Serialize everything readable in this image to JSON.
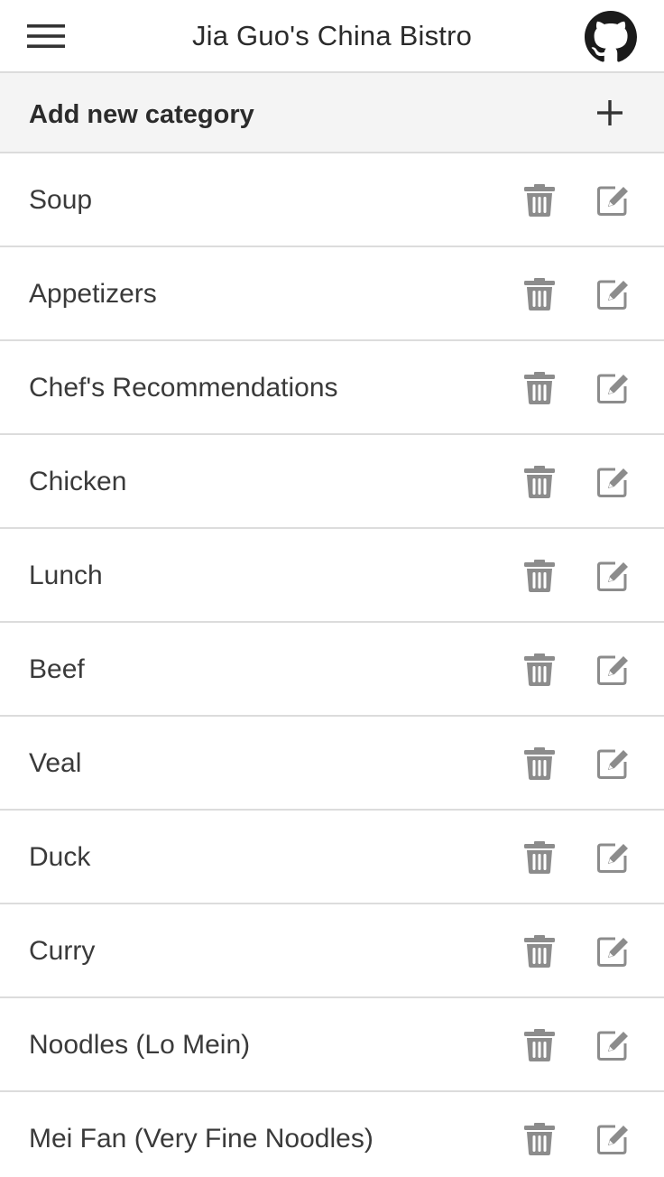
{
  "header": {
    "title": "Jia Guo's China Bistro",
    "menu_icon": "hamburger-menu-icon",
    "github_icon": "github-icon"
  },
  "add_category": {
    "label": "Add new category",
    "icon": "plus-icon"
  },
  "categories": [
    {
      "label": "Soup"
    },
    {
      "label": "Appetizers"
    },
    {
      "label": "Chef's Recommendations"
    },
    {
      "label": "Chicken"
    },
    {
      "label": "Lunch"
    },
    {
      "label": "Beef"
    },
    {
      "label": "Veal"
    },
    {
      "label": "Duck"
    },
    {
      "label": "Curry"
    },
    {
      "label": "Noodles (Lo Mein)"
    },
    {
      "label": "Mei Fan (Very Fine Noodles)"
    }
  ],
  "row_icons": {
    "delete": "trash-icon",
    "edit": "edit-icon"
  },
  "colors": {
    "icon_gray": "#8c8c8c",
    "divider": "#dcdcdc",
    "add_row_bg": "#f4f4f4",
    "github_black": "#1b1b1b"
  }
}
